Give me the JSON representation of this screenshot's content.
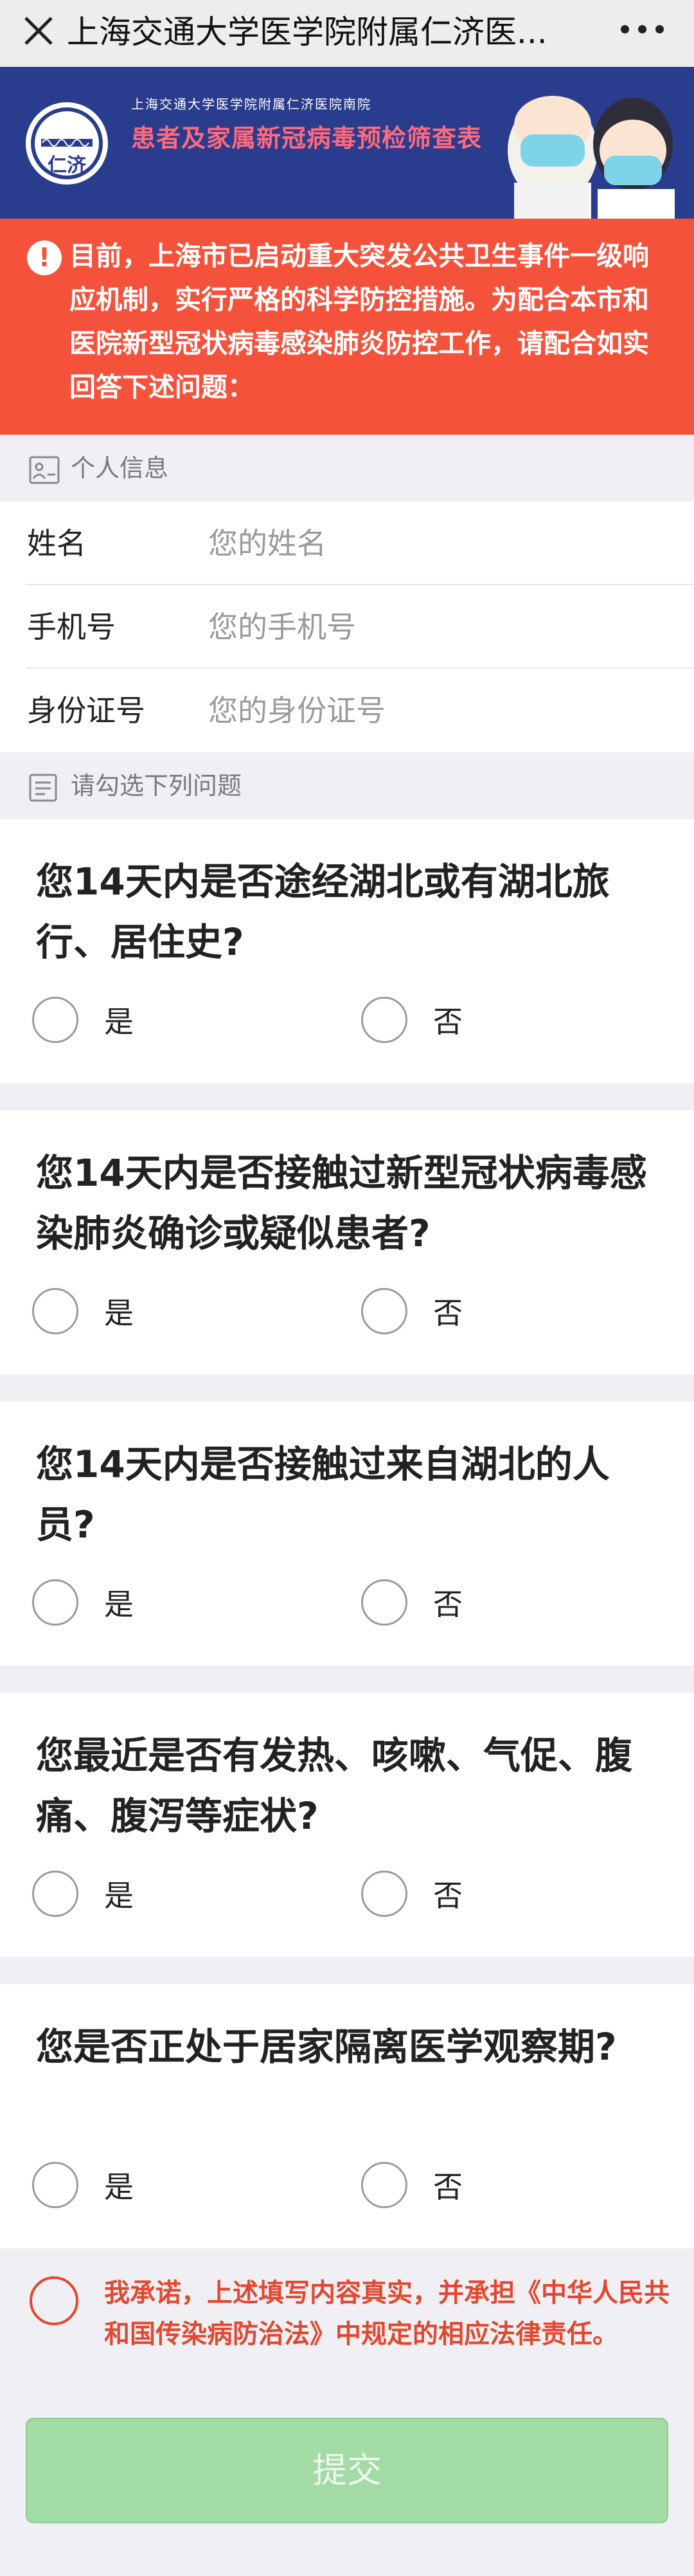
{
  "navbar": {
    "title": "上海交通大学医学院附属仁济医...",
    "close_icon": "close-icon",
    "more_icon": "more-icon"
  },
  "banner": {
    "logo_text": "仁济",
    "logo_year": "1844",
    "small_title": "上海交通大学医学院附属仁济医院南院",
    "big_title": "患者及家属新冠病毒预检筛查表",
    "colors": {
      "background": "#2a3c8e",
      "title": "#ff6a7b"
    }
  },
  "warning": {
    "icon": "exclamation-icon",
    "text": "目前，上海市已启动重大突发公共卫生事件一级响应机制，实行严格的科学防控措施。为配合本市和医院新型冠状病毒感染肺炎防控工作，请配合如实回答下述问题：",
    "color": "#f5523c"
  },
  "personal_section": {
    "header": "个人信息",
    "fields": [
      {
        "label": "姓名",
        "placeholder": "您的姓名",
        "value": ""
      },
      {
        "label": "手机号",
        "placeholder": "您的手机号",
        "value": ""
      },
      {
        "label": "身份证号",
        "placeholder": "您的身份证号",
        "value": ""
      }
    ]
  },
  "questions_section": {
    "header": "请勾选下列问题",
    "questions": [
      {
        "text": "您14天内是否途经湖北或有湖北旅行、居住史?",
        "yes": "是",
        "no": "否"
      },
      {
        "text": "您14天内是否接触过新型冠状病毒感染肺炎确诊或疑似患者?",
        "yes": "是",
        "no": "否"
      },
      {
        "text": "您14天内是否接触过来自湖北的人员?",
        "yes": "是",
        "no": "否"
      },
      {
        "text": "您最近是否有发热、咳嗽、气促、腹痛、腹泻等症状?",
        "yes": "是",
        "no": "否"
      },
      {
        "text": "您是否正处于居家隔离医学观察期?",
        "yes": "是",
        "no": "否"
      }
    ]
  },
  "pledge": {
    "text": "我承诺，上述填写内容真实，并承担《中华人民共和国传染病防治法》中规定的相应法律责任。",
    "color": "#e2482f"
  },
  "submit": {
    "label": "提交",
    "color": "#a2dba4"
  }
}
